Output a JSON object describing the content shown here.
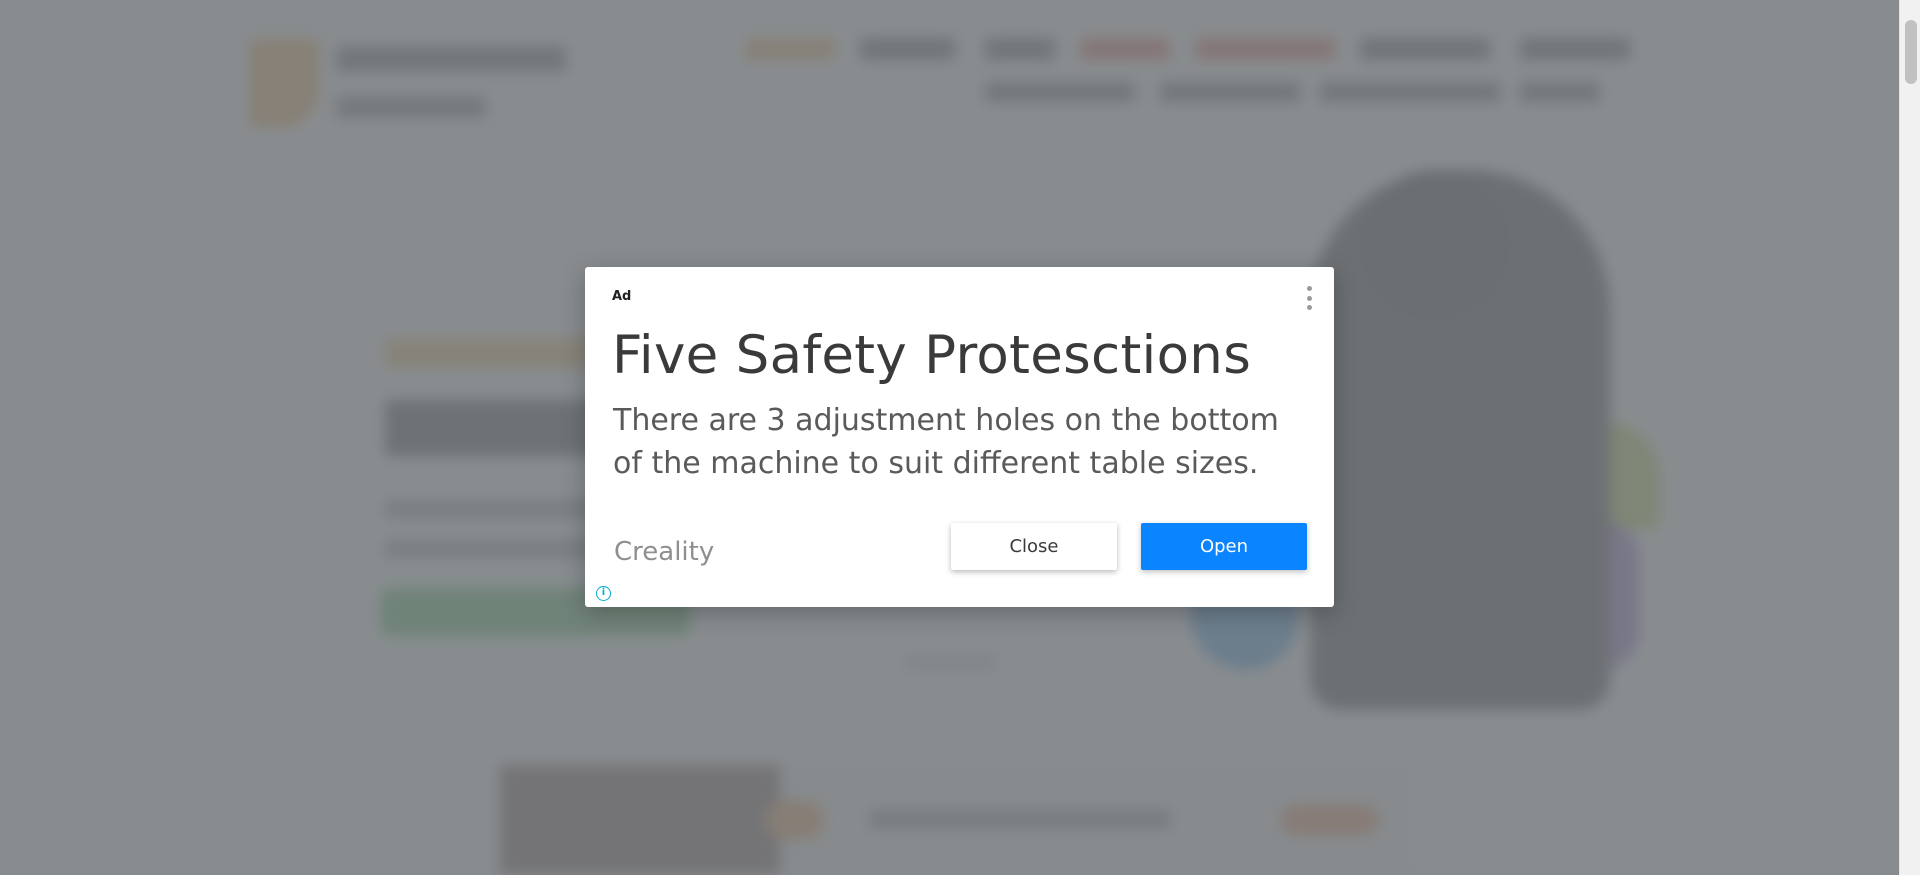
{
  "ad": {
    "label": "Ad",
    "headline": "Five Safety Protesctions",
    "body": "There are 3 adjustment holes on the bottom of the machine to suit different table sizes.",
    "advertiser": "Creality",
    "close_label": "Close",
    "open_label": "Open",
    "menu_icon": "more-vert-icon",
    "info_icon": "info-icon",
    "info_glyph": "i"
  },
  "colors": {
    "open_button": "#0a84ff",
    "info_icon": "#00aecd",
    "overlay": "#7b7f83"
  }
}
